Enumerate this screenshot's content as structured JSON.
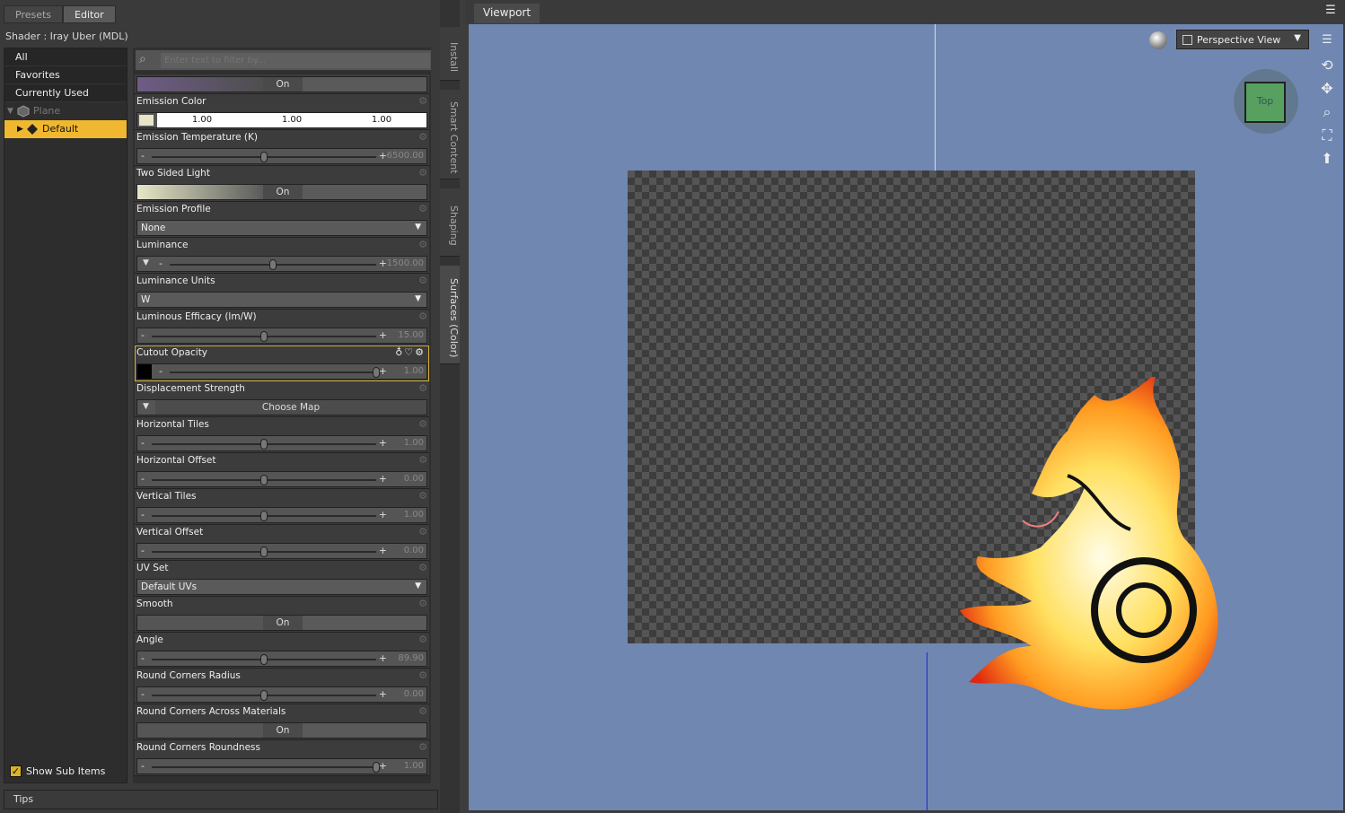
{
  "left_panel": {
    "tabs": [
      "Presets",
      "Editor"
    ],
    "shader_label": "Shader :  Iray Uber (MDL)",
    "categories": [
      "All",
      "Favorites",
      "Currently Used"
    ],
    "tree": {
      "parent": "Plane",
      "child": "Default"
    },
    "show_sub_items": "Show Sub Items",
    "filter_placeholder": "Enter text to filter by...",
    "props": {
      "top_toggle": "On",
      "emission_color": {
        "label": "Emission Color",
        "r": "1.00",
        "g": "1.00",
        "b": "1.00"
      },
      "emission_temp": {
        "label": "Emission Temperature (K)",
        "value": "6500.00",
        "level": 0.5
      },
      "two_sided": {
        "label": "Two Sided Light",
        "value": "On"
      },
      "emission_profile": {
        "label": "Emission Profile",
        "value": "None"
      },
      "luminance": {
        "label": "Luminance",
        "value": "1500.00",
        "level": 0.5
      },
      "luminance_units": {
        "label": "Luminance Units",
        "value": "W"
      },
      "luminous_efficacy": {
        "label": "Luminous Efficacy (lm/W)",
        "value": "15.00",
        "level": 0.5
      },
      "cutout_opacity": {
        "label": "Cutout Opacity",
        "value": "1.00",
        "level": 1
      },
      "displacement": {
        "label": "Displacement Strength",
        "button": "Choose Map"
      },
      "h_tiles": {
        "label": "Horizontal Tiles",
        "value": "1.00",
        "level": 0.5
      },
      "h_offset": {
        "label": "Horizontal Offset",
        "value": "0.00",
        "level": 0.5
      },
      "v_tiles": {
        "label": "Vertical Tiles",
        "value": "1.00",
        "level": 0.5
      },
      "v_offset": {
        "label": "Vertical Offset",
        "value": "0.00",
        "level": 0.5
      },
      "uv_set": {
        "label": "UV Set",
        "value": "Default UVs"
      },
      "smooth": {
        "label": "Smooth",
        "value": "On"
      },
      "angle": {
        "label": "Angle",
        "value": "89.90",
        "level": 0.5
      },
      "rc_radius": {
        "label": "Round Corners Radius",
        "value": "0.00",
        "level": 0.5
      },
      "rc_across": {
        "label": "Round Corners Across Materials",
        "value": "On"
      },
      "rc_roundness": {
        "label": "Round Corners Roundness",
        "value": "1.00",
        "level": 1
      }
    }
  },
  "vertical_tabs": [
    "Install",
    "Smart Content",
    "Shaping",
    "Surfaces (Color)"
  ],
  "tips_label": "Tips",
  "viewport": {
    "tab": "Viewport",
    "view": "Perspective View",
    "cube_label": "Top"
  }
}
